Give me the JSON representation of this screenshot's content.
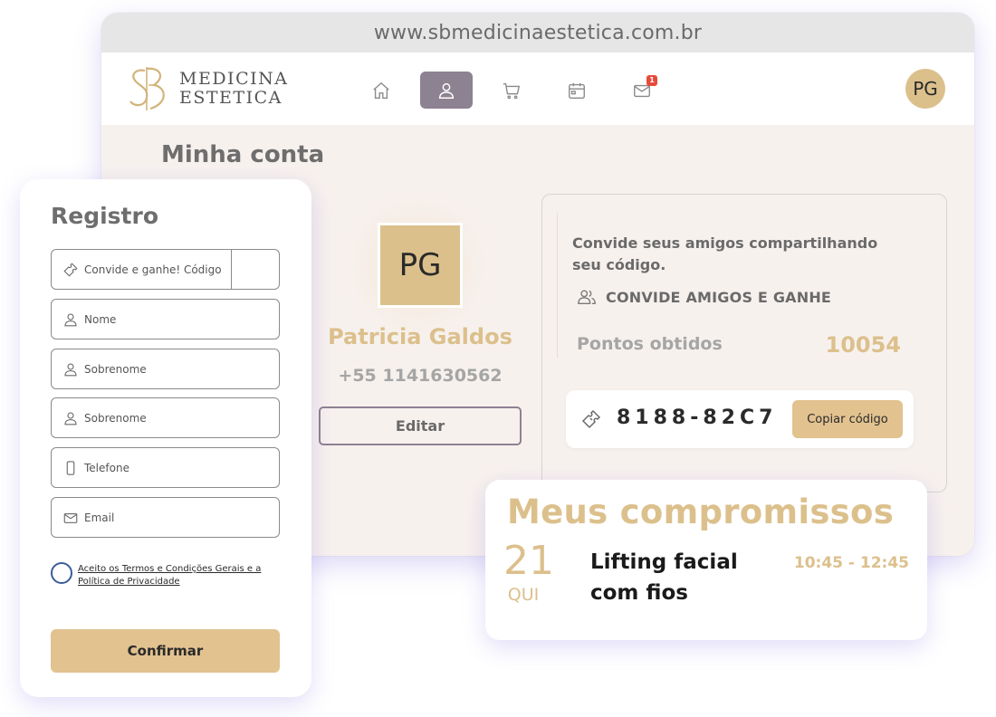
{
  "browser": {
    "url": "www.sbmedicinaestetica.com.br"
  },
  "brand": {
    "logo_line1": "MEDICINA",
    "logo_line2": "ESTETICA",
    "accent_color": "#dcc08c",
    "nav_active_color": "#8d8291"
  },
  "nav": {
    "items": [
      {
        "name": "home",
        "icon": "home-icon"
      },
      {
        "name": "account",
        "icon": "user-icon",
        "active": true
      },
      {
        "name": "cart",
        "icon": "cart-icon"
      },
      {
        "name": "calendar",
        "icon": "calendar-icon"
      },
      {
        "name": "messages",
        "icon": "mail-icon",
        "badge": "1"
      }
    ],
    "avatar_initials": "PG"
  },
  "account": {
    "page_title": "Minha conta",
    "avatar_initials": "PG",
    "name": "Patricia Galdos",
    "phone": "+55 1141630562",
    "edit_label": "Editar"
  },
  "invite": {
    "text": "Convide seus amigos compartilhando seu código.",
    "link_label": "CONVIDE AMIGOS E GANHE",
    "points_label": "Pontos obtidos",
    "points_value": "10054",
    "code": "8188-82C7",
    "copy_label": "Copiar código"
  },
  "register": {
    "title": "Registro",
    "fields": {
      "code": "Convide e ganhe! Código",
      "first_name": "Nome",
      "last_name": "Sobrenome",
      "last_name2": "Sobrenome",
      "phone": "Telefone",
      "email": "Email"
    },
    "terms": "Aceito os Termos e Condições Gerais e a Política de Privacidade",
    "confirm_label": "Confirmar"
  },
  "appointments": {
    "title": "Meus compromissos",
    "items": [
      {
        "day": "21",
        "weekday": "QUI",
        "name": "Lifting facial com fios",
        "time": "10:45 - 12:45"
      }
    ]
  }
}
